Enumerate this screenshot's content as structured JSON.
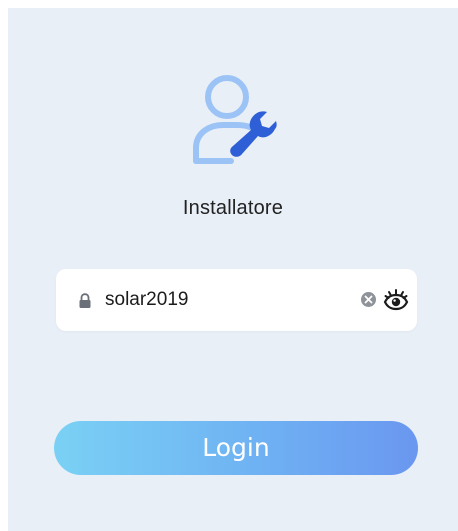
{
  "role": {
    "label": "Installatore",
    "icon": "installer-user-wrench-icon"
  },
  "password_field": {
    "value": "solar2019",
    "lock_icon": "lock-icon",
    "clear_icon": "clear-circle-icon",
    "visibility_icon": "eye-icon"
  },
  "login_button": {
    "label": "Login"
  },
  "colors": {
    "background": "#e9eff7",
    "avatar_light_blue": "#9cc3f5",
    "wrench_blue": "#2f5fd6",
    "button_gradient_start": "#7ad1f4",
    "button_gradient_end": "#6a97f0"
  }
}
